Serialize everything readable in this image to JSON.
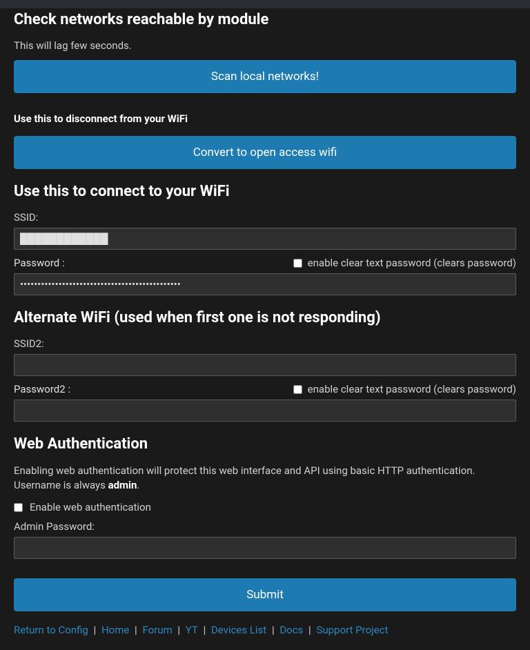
{
  "section_check": {
    "heading": "Check networks reachable by module",
    "desc": "This will lag few seconds.",
    "button": "Scan local networks!"
  },
  "section_disconnect": {
    "heading": "Use this to disconnect from your WiFi",
    "button": "Convert to open access wifi"
  },
  "section_connect": {
    "heading": "Use this to connect to your WiFi",
    "ssid_label": "SSID:",
    "ssid_value": "████████████",
    "password_label": "Password :",
    "password_value": "██████████████████████████████████████████████",
    "clear_text_label": "enable clear text password (clears password)",
    "clear_text_checked": false
  },
  "section_alt": {
    "heading": "Alternate WiFi (used when first one is not responding)",
    "ssid2_label": "SSID2:",
    "ssid2_value": "",
    "password2_label": "Password2 :",
    "password2_value": "",
    "clear_text_label": "enable clear text password (clears password)",
    "clear_text_checked": false
  },
  "section_auth": {
    "heading": "Web Authentication",
    "desc": "Enabling web authentication will protect this web interface and API using basic HTTP authentication. Username is always ",
    "username": "admin",
    "desc_end": ".",
    "enable_label": "Enable web authentication",
    "enable_checked": false,
    "admin_password_label": "Admin Password:",
    "admin_password_value": ""
  },
  "submit_label": "Submit",
  "links": [
    {
      "label": "Return to Config"
    },
    {
      "label": "Home"
    },
    {
      "label": "Forum"
    },
    {
      "label": "YT"
    },
    {
      "label": "Devices List"
    },
    {
      "label": "Docs"
    },
    {
      "label": "Support Project"
    }
  ],
  "link_sep": " | "
}
